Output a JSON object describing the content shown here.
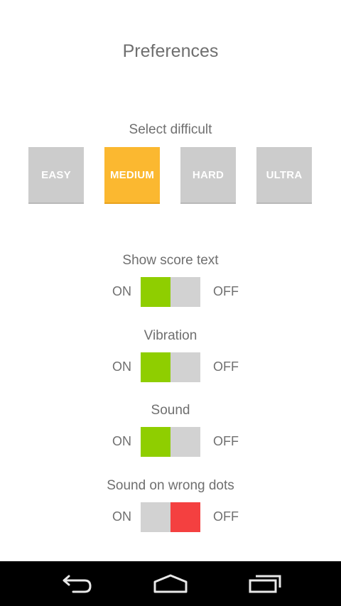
{
  "header": {
    "title": "Preferences"
  },
  "difficulty": {
    "label": "Select difficult",
    "options": [
      "EASY",
      "MEDIUM",
      "HARD",
      "ULTRA"
    ],
    "selected": "MEDIUM"
  },
  "toggles": [
    {
      "label": "Show score text",
      "on_label": "ON",
      "off_label": "OFF",
      "state": "on"
    },
    {
      "label": "Vibration",
      "on_label": "ON",
      "off_label": "OFF",
      "state": "on"
    },
    {
      "label": "Sound",
      "on_label": "ON",
      "off_label": "OFF",
      "state": "on"
    },
    {
      "label": "Sound on wrong dots",
      "on_label": "ON",
      "off_label": "OFF",
      "state": "off"
    }
  ],
  "navbar": {
    "icons": [
      "back-icon",
      "home-icon",
      "recent-apps-icon"
    ]
  },
  "colors": {
    "selected_difficulty": "#fbb830",
    "unselected_difficulty": "#cccccc",
    "toggle_on": "#8fce00",
    "toggle_off": "#f44040",
    "toggle_track": "#d2d2d2",
    "text": "#6f6f6f"
  }
}
